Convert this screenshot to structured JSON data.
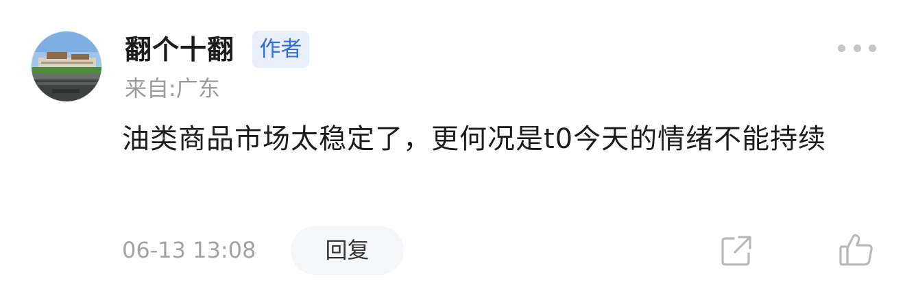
{
  "comment": {
    "user": {
      "name": "翻个十翻",
      "badge": "作者",
      "avatar_icon": "avatar-image"
    },
    "location": "来自:广东",
    "text": "油类商品市场太稳定了，更何况是t0今天的情绪不能持续",
    "timestamp": "06-13 13:08",
    "actions": {
      "reply_label": "回复",
      "more_icon": "more-dots-icon",
      "share_icon": "share-icon",
      "like_icon": "thumbs-up-icon"
    },
    "colors": {
      "badge_bg": "#e9f0fb",
      "badge_text": "#2f6fd6",
      "secondary_text": "#9b9b9b",
      "primary_text": "#1c1c1c",
      "reply_bg": "#f5f6f8",
      "icon": "#b9b9b9"
    }
  }
}
